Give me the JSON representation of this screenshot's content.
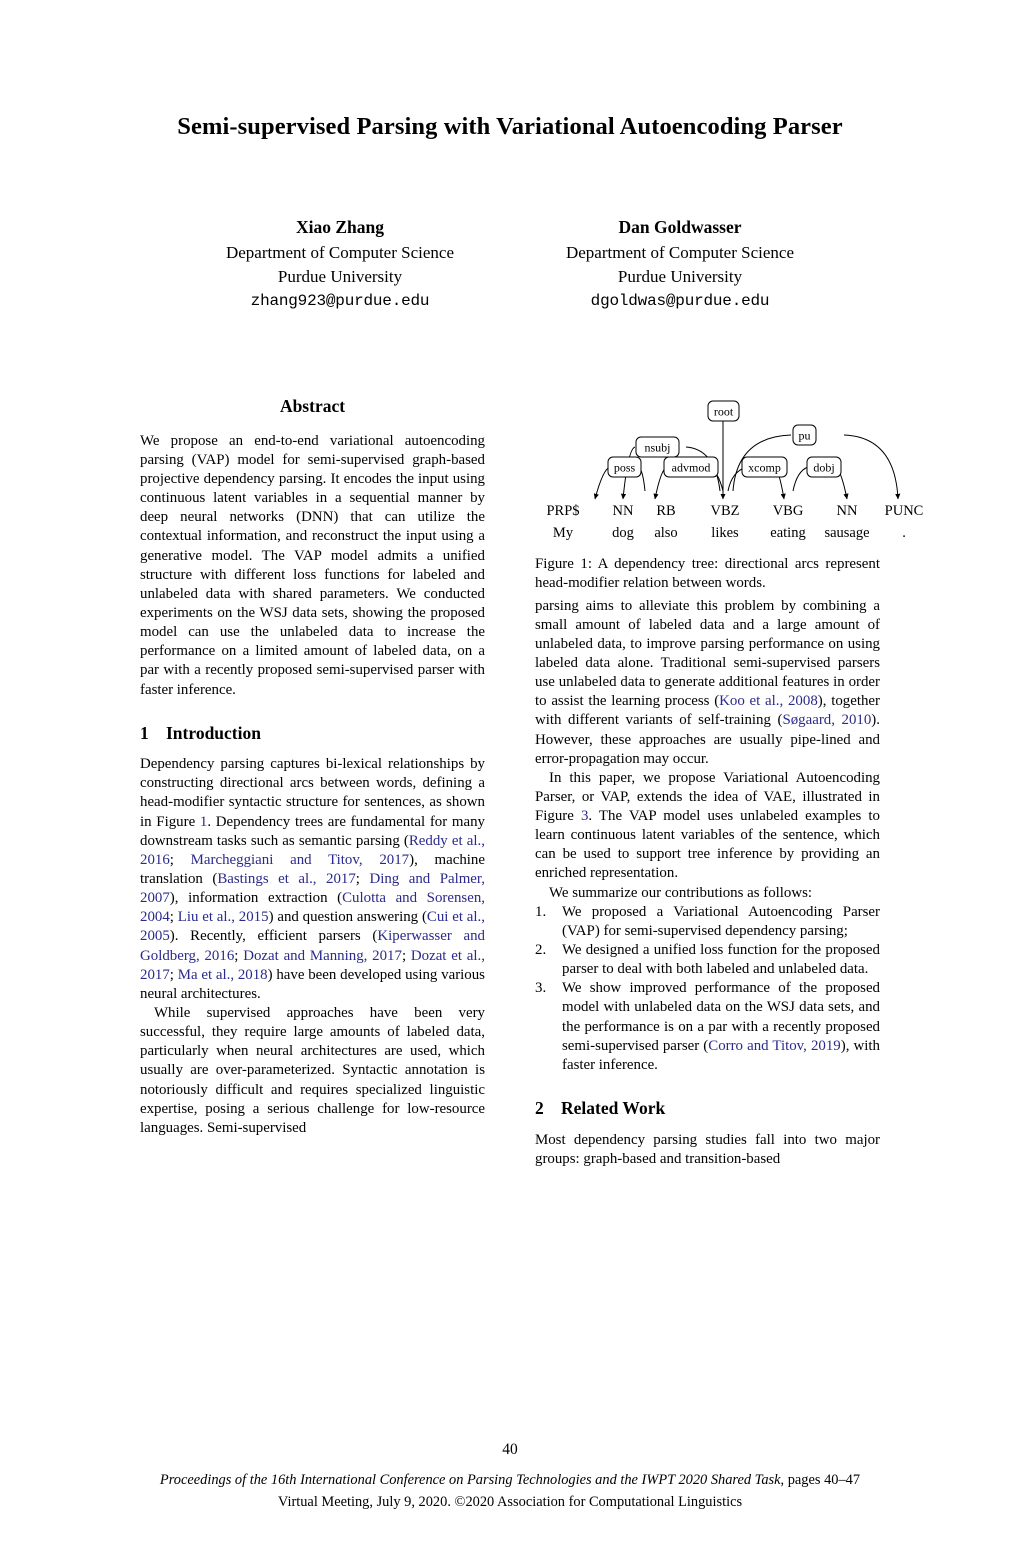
{
  "paper": {
    "title": "Semi-supervised Parsing with Variational Autoencoding Parser",
    "authors": [
      {
        "name": "Xiao Zhang",
        "department": "Department of Computer Science",
        "university": "Purdue University",
        "email": "zhang923@purdue.edu"
      },
      {
        "name": "Dan Goldwasser",
        "department": "Department of Computer Science",
        "university": "Purdue University",
        "email": "dgoldwas@purdue.edu"
      }
    ]
  },
  "abstract": {
    "heading": "Abstract",
    "text": "We propose an end-to-end variational autoencoding parsing (VAP) model for semi-supervised graph-based projective dependency parsing. It encodes the input using continuous latent variables in a sequential manner by deep neural networks (DNN) that can utilize the contextual information, and reconstruct the input using a generative model. The VAP model admits a unified structure with different loss functions for labeled and unlabeled data with shared parameters. We conducted experiments on the WSJ data sets, showing the proposed model can use the unlabeled data to increase the performance on a limited amount of labeled data, on a par with a recently proposed semi-supervised parser with faster inference."
  },
  "sections": {
    "introduction": {
      "number": "1",
      "title": "Introduction",
      "para1_a": "Dependency parsing captures bi-lexical relationships by constructing directional arcs between words, defining a head-modifier syntactic structure for sentences, as shown in Figure ",
      "para1_figref": "1",
      "para1_b": ". Dependency trees are fundamental for many downstream tasks such as semantic parsing (",
      "cite_reddy": "Reddy et al., 2016",
      "sep1": "; ",
      "cite_marcheggiani": "Marcheggiani and Titov, 2017",
      "para1_c": "), machine translation (",
      "cite_bastings": "Bastings et al., 2017",
      "cite_ding": "Ding and Palmer, 2007",
      "para1_d": "), information extraction (",
      "cite_culotta": "Culotta and Sorensen, 2004",
      "cite_liu": "Liu et al., 2015",
      "para1_e": ") and question answering (",
      "cite_cui": "Cui et al., 2005",
      "para1_f": "). Recently, efficient parsers (",
      "cite_kiperwasser": "Kiperwasser and Goldberg, 2016",
      "cite_dozat_manning": "Dozat and Manning, 2017",
      "cite_dozat_etal": "Dozat et al., 2017",
      "cite_ma": "Ma et al., 2018",
      "para1_g": ") have been developed using various neural architectures.",
      "para2": "While supervised approaches have been very successful, they require large amounts of labeled data, particularly when neural architectures are used, which usually are over-parameterized. Syntactic annotation is notoriously difficult and requires specialized linguistic expertise, posing a serious challenge for low-resource languages. Semi-supervised",
      "para3_a": "parsing aims to alleviate this problem by combining a small amount of labeled data and a large amount of unlabeled data, to improve parsing performance on using labeled data alone. Traditional semi-supervised parsers use unlabeled data to generate additional features in order to assist the learning process (",
      "cite_koo": "Koo et al., 2008",
      "para3_b": "), together with different variants of self-training (",
      "cite_sogaard": "Søgaard, 2010",
      "para3_c": "). However, these approaches are usually pipe-lined and error-propagation may occur.",
      "para4_a": "In this paper, we propose Variational Autoencoding Parser, or VAP, extends the idea of VAE, illustrated in Figure ",
      "para4_figref": "3",
      "para4_b": ". The VAP model uses unlabeled examples to learn continuous latent variables of the sentence, which can be used to support tree inference by providing an enriched representation.",
      "contributions_lead": "We summarize our contributions as follows:",
      "contributions": [
        {
          "text": "We proposed a Variational Autoencoding Parser (VAP) for semi-supervised dependency parsing;"
        },
        {
          "text": "We designed a unified loss function for the proposed parser to deal with both labeled and unlabeled data."
        },
        {
          "text_a": "We show improved performance of the proposed model with unlabeled data on the WSJ data sets, and the performance is on a par with a recently proposed semi-supervised parser (",
          "cite": "Corro and Titov, 2019",
          "text_b": "), with faster inference."
        }
      ]
    },
    "related_work": {
      "number": "2",
      "title": "Related Work",
      "para1": "Most dependency parsing studies fall into two major groups: graph-based and transition-based"
    }
  },
  "figure1": {
    "caption_label": "Figure 1:",
    "caption_text": " A dependency tree: directional arcs represent head-modifier relation between words.",
    "tokens": [
      {
        "pos": "PRP$",
        "word": "My"
      },
      {
        "pos": "NN",
        "word": "dog"
      },
      {
        "pos": "RB",
        "word": "also"
      },
      {
        "pos": "VBZ",
        "word": "likes"
      },
      {
        "pos": "VBG",
        "word": "eating"
      },
      {
        "pos": "NN",
        "word": "sausage"
      },
      {
        "pos": "PUNC",
        "word": "."
      }
    ],
    "arcs": [
      {
        "label": "root",
        "head": "ROOT",
        "modifier": "VBZ"
      },
      {
        "label": "poss",
        "head": "NN",
        "modifier": "PRP$"
      },
      {
        "label": "nsubj",
        "head": "VBZ",
        "modifier": "NN"
      },
      {
        "label": "advmod",
        "head": "VBZ",
        "modifier": "RB"
      },
      {
        "label": "xcomp",
        "head": "VBZ",
        "modifier": "VBG"
      },
      {
        "label": "dobj",
        "head": "VBG",
        "modifier": "NN"
      },
      {
        "label": "pu",
        "head": "VBZ",
        "modifier": "PUNC"
      }
    ]
  },
  "footer": {
    "page_number": "40",
    "line1_italic": "Proceedings of the 16th International Conference on Parsing Technologies and the IWPT 2020 Shared Task",
    "line1_rest": ", pages 40–47",
    "line2": "Virtual Meeting, July 9, 2020. ©2020 Association for Computational Linguistics"
  }
}
